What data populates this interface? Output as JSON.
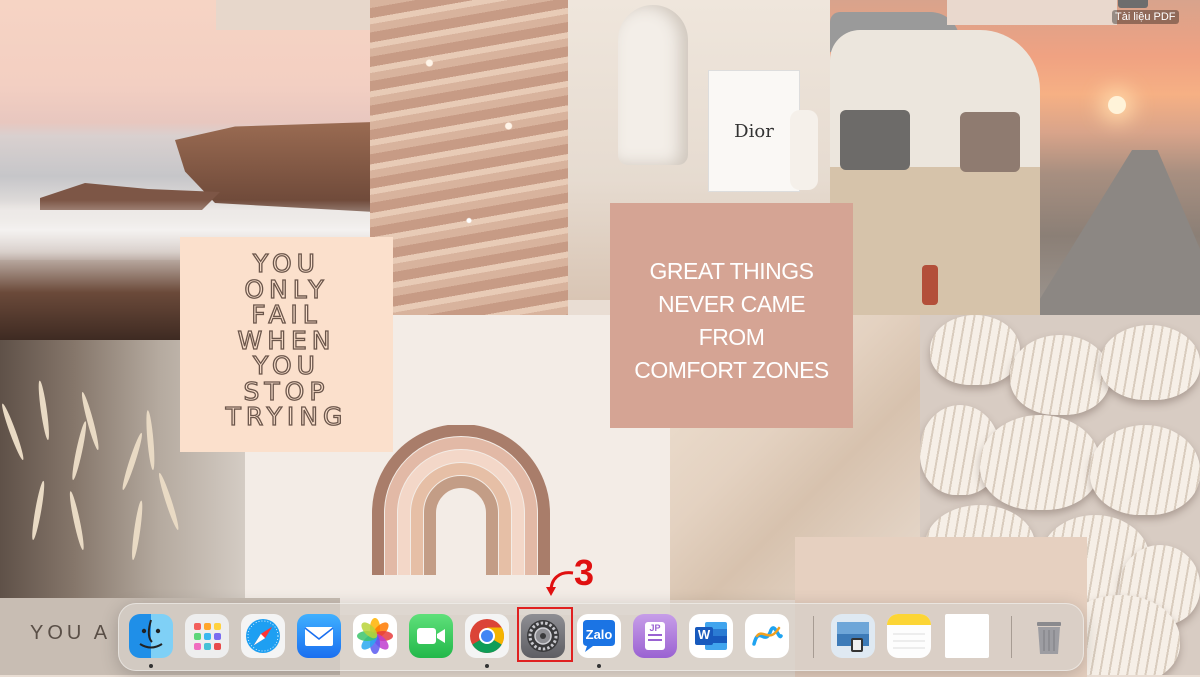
{
  "desktop": {
    "quote_left": "YOU\nONLY\nFAIL\nWHEN\nYOU\nSTOP\nTRYING",
    "quote_right": "GREAT THINGS\nNEVER CAME\nFROM\nCOMFORT ZONES",
    "bag_brand": "Dior",
    "bottom_left_text": "YOU  A",
    "file_label": "Tài liệu PDF"
  },
  "annotation": {
    "step_number": "3",
    "highlight_color": "#e02020"
  },
  "dock": {
    "apps": [
      {
        "name": "Finder",
        "icon": "finder-icon",
        "running": true
      },
      {
        "name": "Launchpad",
        "icon": "launchpad-icon",
        "running": false
      },
      {
        "name": "Safari",
        "icon": "safari-icon",
        "running": false
      },
      {
        "name": "Mail",
        "icon": "mail-icon",
        "running": false
      },
      {
        "name": "Photos",
        "icon": "photos-icon",
        "running": false
      },
      {
        "name": "FaceTime",
        "icon": "facetime-icon",
        "running": false
      },
      {
        "name": "Google Chrome",
        "icon": "chrome-icon",
        "running": true
      },
      {
        "name": "System Settings",
        "icon": "gear-icon",
        "running": false
      },
      {
        "name": "Zalo",
        "icon": "zalo-icon",
        "running": true,
        "label": "Zalo"
      },
      {
        "name": "Dictionary",
        "icon": "dictionary-icon",
        "running": false,
        "label": "JP"
      },
      {
        "name": "Microsoft Word",
        "icon": "word-icon",
        "running": false,
        "label": "W"
      },
      {
        "name": "Freeform",
        "icon": "freeform-icon",
        "running": false
      },
      {
        "name": "Preview",
        "icon": "preview-icon",
        "running": false
      },
      {
        "name": "Notes",
        "icon": "notes-icon",
        "running": false
      },
      {
        "name": "Blank Document",
        "icon": "document-icon",
        "running": false
      },
      {
        "name": "Trash",
        "icon": "trash-icon",
        "running": false
      }
    ]
  }
}
